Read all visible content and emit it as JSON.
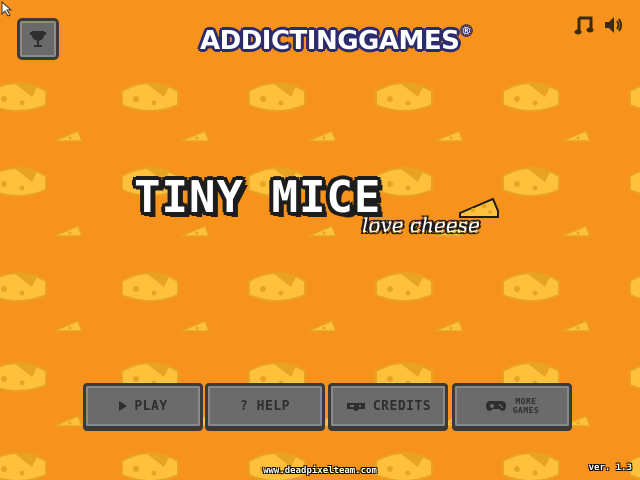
{
  "header": {
    "brand_primary": "ADDICTINGGAMES",
    "brand_mark": "®"
  },
  "title": {
    "main": "TINY MICE",
    "sub": "love cheese"
  },
  "menu": {
    "play_label": "PLAY",
    "help_label": "? HELP",
    "credits_label": "CREDITS",
    "more_games_label": "MORE\nGAMES"
  },
  "footer": {
    "website": "www.deadpixelteam.com",
    "version": "ver. 1.3"
  },
  "icons": {
    "trophy": "trophy-icon",
    "music": "music-note-icon",
    "sound": "speaker-icon",
    "play": "play-triangle-icon",
    "credits": "controller-icon",
    "more_games": "gamepad-icon"
  },
  "colors": {
    "background": "#f7921c",
    "cheese": "#ffc13b",
    "cheese_shade": "#e8a224",
    "button_face": "#6b6b6b",
    "button_border": "#3a3a3a",
    "button_text": "#2e2e2e",
    "brand_outline": "#2b2b6e"
  }
}
